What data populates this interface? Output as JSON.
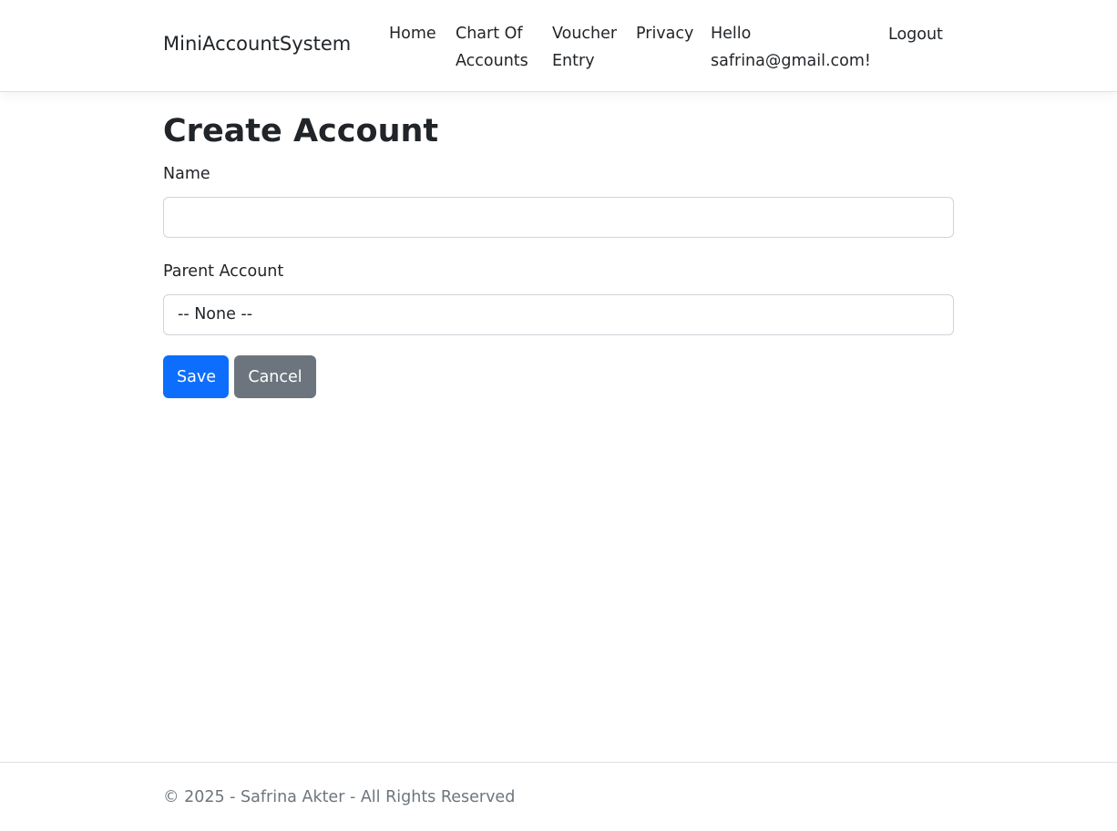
{
  "navbar": {
    "brand": "MiniAccountSystem",
    "links": [
      "Home",
      "Chart Of",
      "Accounts",
      "Voucher",
      "Entry",
      "Privacy"
    ],
    "greeting_line1": "Hello",
    "greeting_line2": "safrina@gmail.com!",
    "logout": "Logout"
  },
  "form": {
    "title": "Create Account",
    "name_label": "Name",
    "name_value": "",
    "parent_label": "Parent Account",
    "parent_selected": "-- None --",
    "save": "Save",
    "cancel": "Cancel"
  },
  "colors": {
    "primary": "#0d6efd",
    "secondary": "#6c757d"
  },
  "footer": {
    "text": "© 2025 - Safrina Akter - All Rights Reserved"
  }
}
